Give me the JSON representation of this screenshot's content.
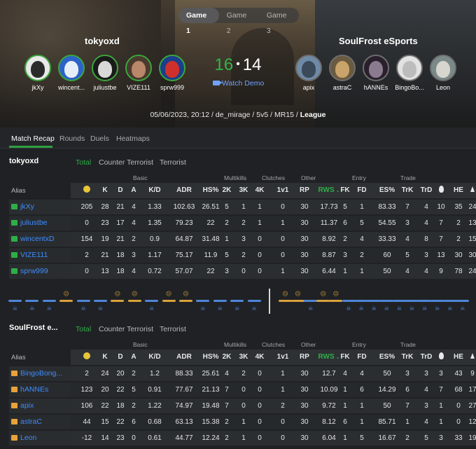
{
  "game_tabs": [
    "Game 1",
    "Game 2",
    "Game 3"
  ],
  "teams": {
    "left": {
      "name": "tokyoxd",
      "players": [
        "jkXy",
        "wincent...",
        "juliustbe",
        "VIZE111",
        "sprw999"
      ]
    },
    "right": {
      "name": "SoulFrost eSports",
      "players": [
        "apix",
        "astraC",
        "hANNEs",
        "BingoBo...",
        "Leon"
      ]
    }
  },
  "score": {
    "left": "16",
    "separator": "•",
    "right": "14"
  },
  "watch_demo": "Watch Demo",
  "match_meta": {
    "date": "05/06/2023, 20:12",
    "map": "de_mirage",
    "mode": "5v5",
    "format": "MR15",
    "type": "League",
    "sep": " / "
  },
  "sub_tabs": [
    "Match Recap",
    "Rounds",
    "Duels",
    "Heatmaps"
  ],
  "side_tabs": [
    "Total",
    "Counter Terrorist",
    "Terrorist"
  ],
  "group_labels": {
    "basic": "Basic",
    "multikills": "Multikills",
    "clutches": "Clutches",
    "other": "Other",
    "entry": "Entry",
    "trade": "Trade"
  },
  "alias_label": "Alias",
  "columns": [
    "",
    "K",
    "D",
    "A",
    "K/D",
    "ADR",
    "HS%",
    "2K",
    "3K",
    "4K",
    "1v1",
    "RP",
    "RWS",
    "FK",
    "FD",
    "ES%",
    "TrK",
    "TrD",
    "",
    "HE",
    ""
  ],
  "section_one": {
    "title": "tokyoxd",
    "rows": [
      {
        "alias": "jkXy",
        "v": [
          "205",
          "28",
          "21",
          "4",
          "1.33",
          "102.63",
          "26.51",
          "5",
          "1",
          "1",
          "0",
          "30",
          "17.73",
          "5",
          "1",
          "83.33",
          "7",
          "4",
          "10",
          "35",
          "24"
        ]
      },
      {
        "alias": "juliustbe",
        "v": [
          "0",
          "23",
          "17",
          "4",
          "1.35",
          "79.23",
          "22",
          "2",
          "2",
          "1",
          "1",
          "30",
          "11.37",
          "6",
          "5",
          "54.55",
          "3",
          "4",
          "7",
          "2",
          "13"
        ]
      },
      {
        "alias": "wincentxD",
        "v": [
          "154",
          "19",
          "21",
          "2",
          "0.9",
          "64.87",
          "31.48",
          "1",
          "3",
          "0",
          "0",
          "30",
          "8.92",
          "2",
          "4",
          "33.33",
          "4",
          "8",
          "7",
          "2",
          "15"
        ]
      },
      {
        "alias": "VIZE111",
        "v": [
          "2",
          "21",
          "18",
          "3",
          "1.17",
          "75.17",
          "11.9",
          "5",
          "2",
          "0",
          "0",
          "30",
          "8.87",
          "3",
          "2",
          "60",
          "5",
          "3",
          "13",
          "30",
          "30"
        ]
      },
      {
        "alias": "sprw999",
        "v": [
          "0",
          "13",
          "18",
          "4",
          "0.72",
          "57.07",
          "22",
          "3",
          "0",
          "0",
          "1",
          "30",
          "6.44",
          "1",
          "1",
          "50",
          "4",
          "4",
          "9",
          "78",
          "24"
        ]
      }
    ]
  },
  "section_two": {
    "title": "SoulFrost e...",
    "rows": [
      {
        "alias": "BingoBong...",
        "v": [
          "2",
          "24",
          "20",
          "2",
          "1.2",
          "88.33",
          "25.61",
          "4",
          "2",
          "0",
          "1",
          "30",
          "12.7",
          "4",
          "4",
          "50",
          "3",
          "3",
          "3",
          "43",
          "9"
        ]
      },
      {
        "alias": "hANNEs",
        "v": [
          "123",
          "20",
          "22",
          "5",
          "0.91",
          "77.67",
          "21.13",
          "7",
          "0",
          "0",
          "1",
          "30",
          "10.09",
          "1",
          "6",
          "14.29",
          "6",
          "4",
          "7",
          "68",
          "17"
        ]
      },
      {
        "alias": "apix",
        "v": [
          "106",
          "22",
          "18",
          "2",
          "1.22",
          "74.97",
          "19.48",
          "7",
          "0",
          "0",
          "2",
          "30",
          "9.72",
          "1",
          "1",
          "50",
          "7",
          "3",
          "1",
          "0",
          "27"
        ]
      },
      {
        "alias": "astraC",
        "v": [
          "44",
          "15",
          "22",
          "6",
          "0.68",
          "63.13",
          "15.38",
          "2",
          "1",
          "0",
          "0",
          "30",
          "8.12",
          "6",
          "1",
          "85.71",
          "1",
          "4",
          "1",
          "0",
          "12"
        ]
      },
      {
        "alias": "Leon",
        "v": [
          "-12",
          "14",
          "23",
          "0",
          "0.61",
          "44.77",
          "12.24",
          "2",
          "1",
          "0",
          "0",
          "30",
          "6.04",
          "1",
          "5",
          "16.67",
          "2",
          "5",
          "3",
          "33",
          "19"
        ]
      }
    ]
  },
  "rounds": {
    "first_half": [
      "ct",
      "ct",
      "ct",
      "t",
      "ct",
      "ct",
      "t",
      "t",
      "ct",
      "t",
      "t",
      "ct",
      "ct",
      "ct",
      "ct"
    ],
    "second_half": [
      "t",
      "t",
      "ct",
      "t",
      "t",
      "ct",
      "ct",
      "ct",
      "ct",
      "ct",
      "ct",
      "ct",
      "ct",
      "ct",
      "ct"
    ]
  }
}
